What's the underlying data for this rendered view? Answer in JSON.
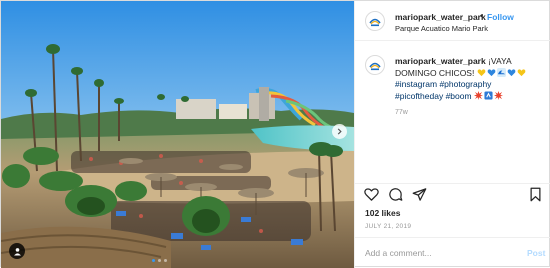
{
  "post": {
    "header": {
      "username": "mariopark_water_park",
      "separator": "•",
      "follow_label": "Follow",
      "location": "Parque Acuatico Mario Park"
    },
    "caption": {
      "username": "mariopark_water_park",
      "text": "¡VAYA DOMINGO CHICOS!",
      "emojis": [
        "yellow-heart",
        "blue-heart",
        "water-wave",
        "blue-heart",
        "yellow-heart"
      ],
      "hashtags": [
        "#instagram",
        "#photography",
        "#picoftheday",
        "#boom"
      ],
      "trailing_emojis": [
        "collision",
        "sos-square",
        "collision"
      ],
      "time_ago": "77w"
    },
    "likes": "102 likes",
    "date": "JULY 21, 2019",
    "comment": {
      "placeholder": "Add a comment...",
      "value": "",
      "post_label": "Post"
    },
    "carousel": {
      "slides": 3,
      "active": 1
    },
    "colors": {
      "link_blue": "#3897f0",
      "hashtag": "#003569",
      "post_disabled": "#b3dbff",
      "muted": "#999999"
    }
  }
}
